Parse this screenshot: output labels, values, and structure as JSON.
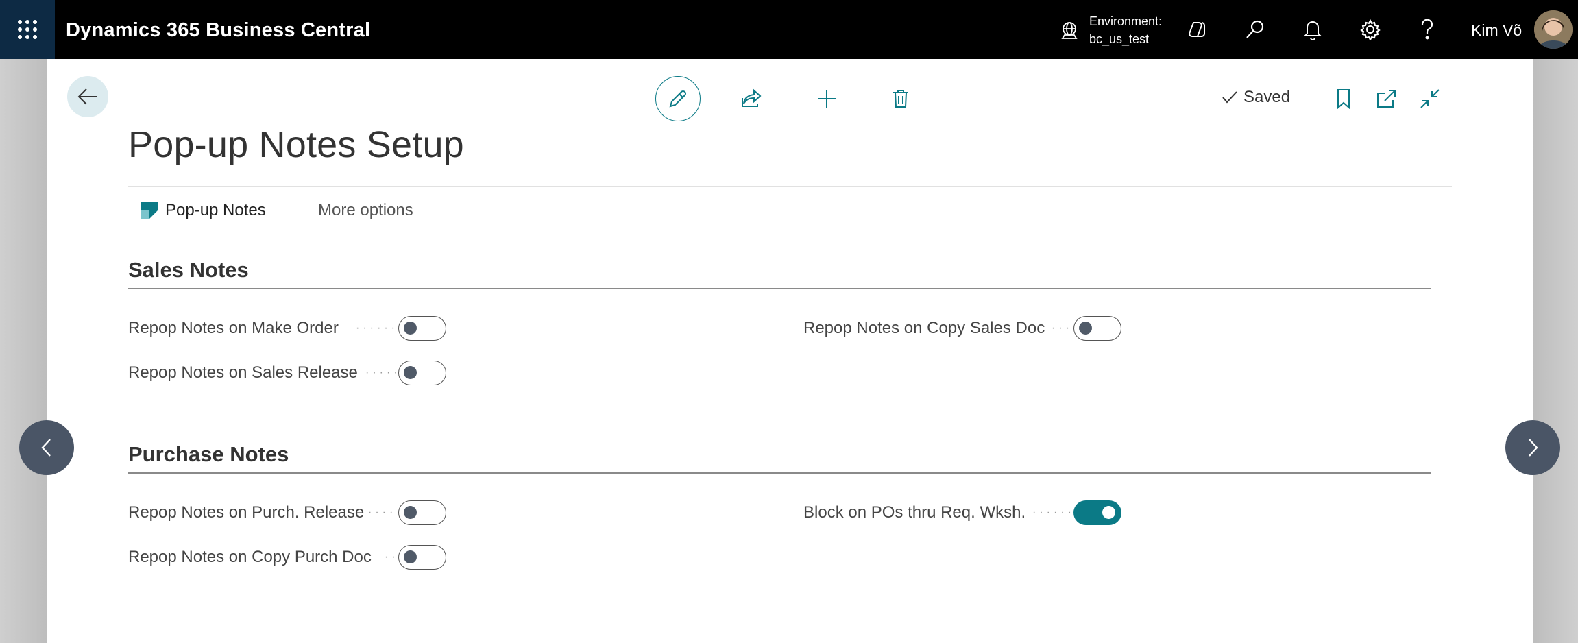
{
  "header": {
    "app_title": "Dynamics 365 Business Central",
    "environment_label": "Environment:",
    "environment_value": "bc_us_test",
    "user_name": "Kim Võ"
  },
  "actions": {
    "saved_label": "Saved"
  },
  "page": {
    "title": "Pop-up Notes Setup"
  },
  "action_bar": {
    "items": [
      {
        "label": "Pop-up Notes"
      },
      {
        "label": "More options"
      }
    ]
  },
  "sections": [
    {
      "title": "Sales Notes",
      "fields": [
        {
          "label": "Repop Notes on Make Order",
          "value": false
        },
        {
          "label": "Repop Notes on Sales Release",
          "value": false
        },
        {
          "label": "Repop Notes on Copy Sales Doc",
          "value": false
        }
      ]
    },
    {
      "title": "Purchase Notes",
      "fields": [
        {
          "label": "Repop Notes on Purch. Release",
          "value": false
        },
        {
          "label": "Repop Notes on Copy Purch Doc",
          "value": false
        },
        {
          "label": "Block on POs thru Req. Wksh.",
          "value": true
        }
      ]
    }
  ],
  "colors": {
    "accent": "#0b7a86",
    "topbar": "#000000",
    "waffle_bg": "#0d2a44"
  },
  "icons": [
    "waffle-icon",
    "environment-icon",
    "copilot-icon",
    "search-icon",
    "bell-icon",
    "gear-icon",
    "help-icon",
    "back-arrow-icon",
    "pencil-icon",
    "share-icon",
    "plus-icon",
    "trash-icon",
    "checkmark-icon",
    "bookmark-icon",
    "open-new-window-icon",
    "collapse-icon",
    "pop-up-notes-icon",
    "chevron-left-icon",
    "chevron-right-icon"
  ]
}
